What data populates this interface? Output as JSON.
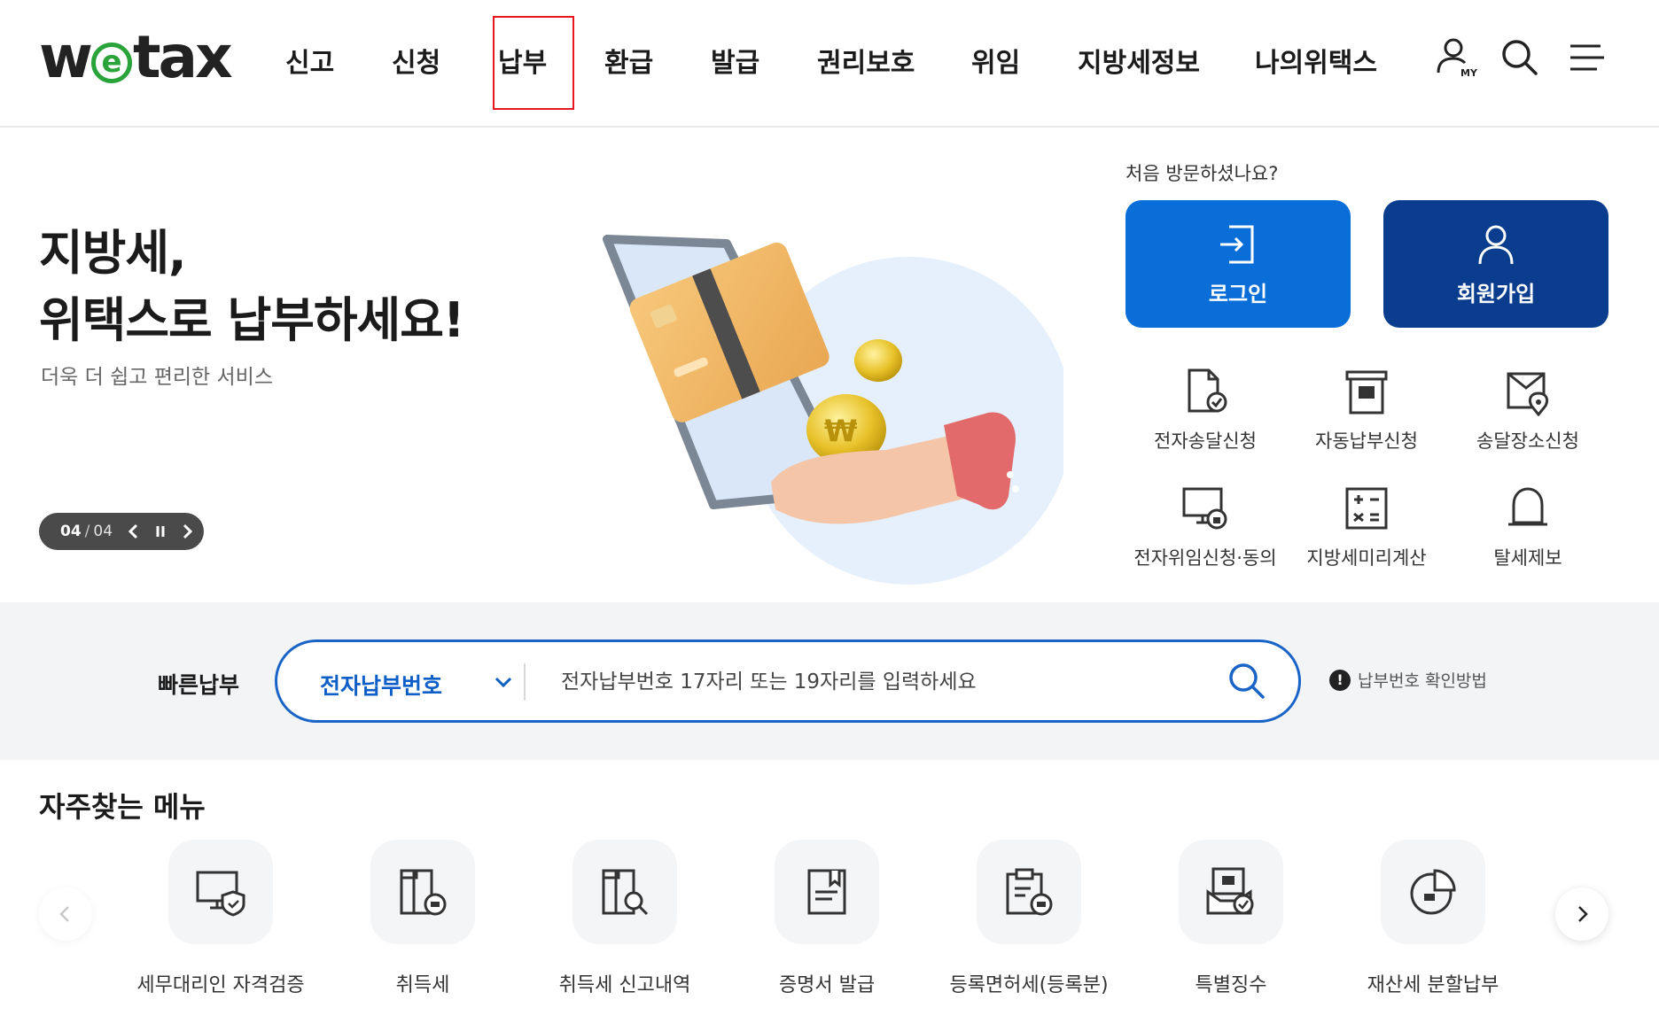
{
  "header": {
    "logo": {
      "pre": "w",
      "mid": "e",
      "post": "tax"
    },
    "nav": [
      "신고",
      "신청",
      "납부",
      "환급",
      "발급",
      "권리보호",
      "위임",
      "지방세정보",
      "나의위택스"
    ],
    "highlighted_nav": "납부",
    "icons": [
      "my-page-icon",
      "search-icon",
      "menu-icon"
    ]
  },
  "hero": {
    "title_line1": "지방세,",
    "title_line2": "위택스로 납부하세요!",
    "subtitle": "더욱 더 쉽고 편리한 서비스",
    "pager": {
      "current": "04",
      "separator": "/",
      "total": "04"
    }
  },
  "account": {
    "prompt": "처음 방문하셨나요?",
    "login_label": "로그인",
    "join_label": "회원가입"
  },
  "services": [
    {
      "label": "전자송달신청",
      "icon": "e-delivery-icon"
    },
    {
      "label": "자동납부신청",
      "icon": "auto-pay-icon"
    },
    {
      "label": "송달장소신청",
      "icon": "delivery-location-icon"
    },
    {
      "label": "전자위임신청·동의",
      "icon": "e-delegation-icon"
    },
    {
      "label": "지방세미리계산",
      "icon": "calculator-icon"
    },
    {
      "label": "탈세제보",
      "icon": "report-bell-icon"
    }
  ],
  "quick_pay": {
    "title": "빠른납부",
    "select_value": "전자납부번호",
    "placeholder": "전자납부번호 17자리 또는 19자리를 입력하세요",
    "help": "납부번호 확인방법"
  },
  "frequent": {
    "title": "자주찾는 메뉴",
    "items": [
      {
        "label": "세무대리인 자격검증",
        "icon": "monitor-shield-icon"
      },
      {
        "label": "취득세",
        "icon": "building-won-icon"
      },
      {
        "label": "취득세 신고내역",
        "icon": "building-search-icon"
      },
      {
        "label": "증명서 발급",
        "icon": "certificate-icon"
      },
      {
        "label": "등록면허세(등록분)",
        "icon": "clipboard-won-icon"
      },
      {
        "label": "특별징수",
        "icon": "won-check-icon"
      },
      {
        "label": "재산세 분할납부",
        "icon": "pie-chart-icon"
      }
    ]
  },
  "colors": {
    "primary": "#0a6ed9",
    "navy": "#0a3d8e",
    "brand_green": "#2aa33a",
    "highlight_red": "#e8161d"
  }
}
